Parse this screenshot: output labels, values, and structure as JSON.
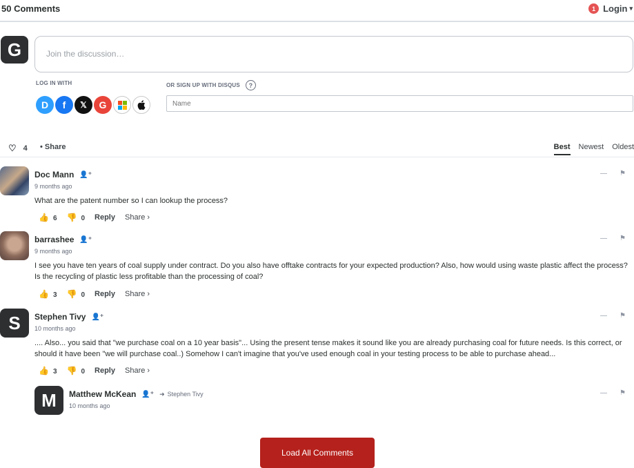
{
  "header": {
    "comment_count": "50 Comments",
    "notification_count": "1",
    "login_label": "Login",
    "caret": "▾"
  },
  "composer": {
    "avatar_letter": "G",
    "placeholder": "Join the discussion…"
  },
  "auth": {
    "login_with_label": "LOG IN WITH",
    "signup_label": "OR SIGN UP WITH DISQUS",
    "help_symbol": "?",
    "providers": [
      "disqus-icon",
      "facebook-icon",
      "x-icon",
      "google-icon",
      "microsoft-icon",
      "apple-icon"
    ],
    "name_placeholder": "Name"
  },
  "toolbar": {
    "heart_symbol": "♡",
    "vote_count": "4",
    "share_label": "• Share",
    "sorts": [
      "Best",
      "Newest",
      "Oldest"
    ]
  },
  "comments": [
    {
      "author": "Doc Mann",
      "time": "9 months ago",
      "text": "What are the patent number so I can lookup the process?",
      "upvotes": "6",
      "downvotes": "0",
      "reply_label": "Reply",
      "share_label": "Share ›"
    },
    {
      "author": "barrashee",
      "time": "9 months ago",
      "text": "I see you have ten years of coal supply under contract. Do you also have offtake contracts for your expected production? Also, how would using waste plastic affect the process? Is the recycling of plastic less profitable than the processing of coal?",
      "upvotes": "3",
      "downvotes": "0",
      "reply_label": "Reply",
      "share_label": "Share ›"
    },
    {
      "author": "Stephen Tivy",
      "avatar_letter": "S",
      "time": "10 months ago",
      "text": ".... Also... you said that \"we purchase coal on a 10 year basis\"... Using the present tense makes it sound like you are already purchasing coal for future needs. Is this correct, or should it have been \"we will purchase coal..) Somehow I can't imagine that you've used enough coal in your testing process to be able to purchase ahead...",
      "upvotes": "3",
      "downvotes": "0",
      "reply_label": "Reply",
      "share_label": "Share ›"
    }
  ],
  "reply": {
    "author": "Matthew McKean",
    "avatar_letter": "M",
    "in_reply_to": "Stephen Tivy",
    "time": "10 months ago"
  },
  "icons": {
    "follow": "👤⁺",
    "collapse": "—",
    "flag": "⚑",
    "thumb_up": "👍",
    "thumb_down": "👎",
    "reply_arrow": "➜"
  },
  "load_more_label": "Load All Comments",
  "colors": {
    "accent": "#b5211c",
    "badge": "#e55353"
  }
}
